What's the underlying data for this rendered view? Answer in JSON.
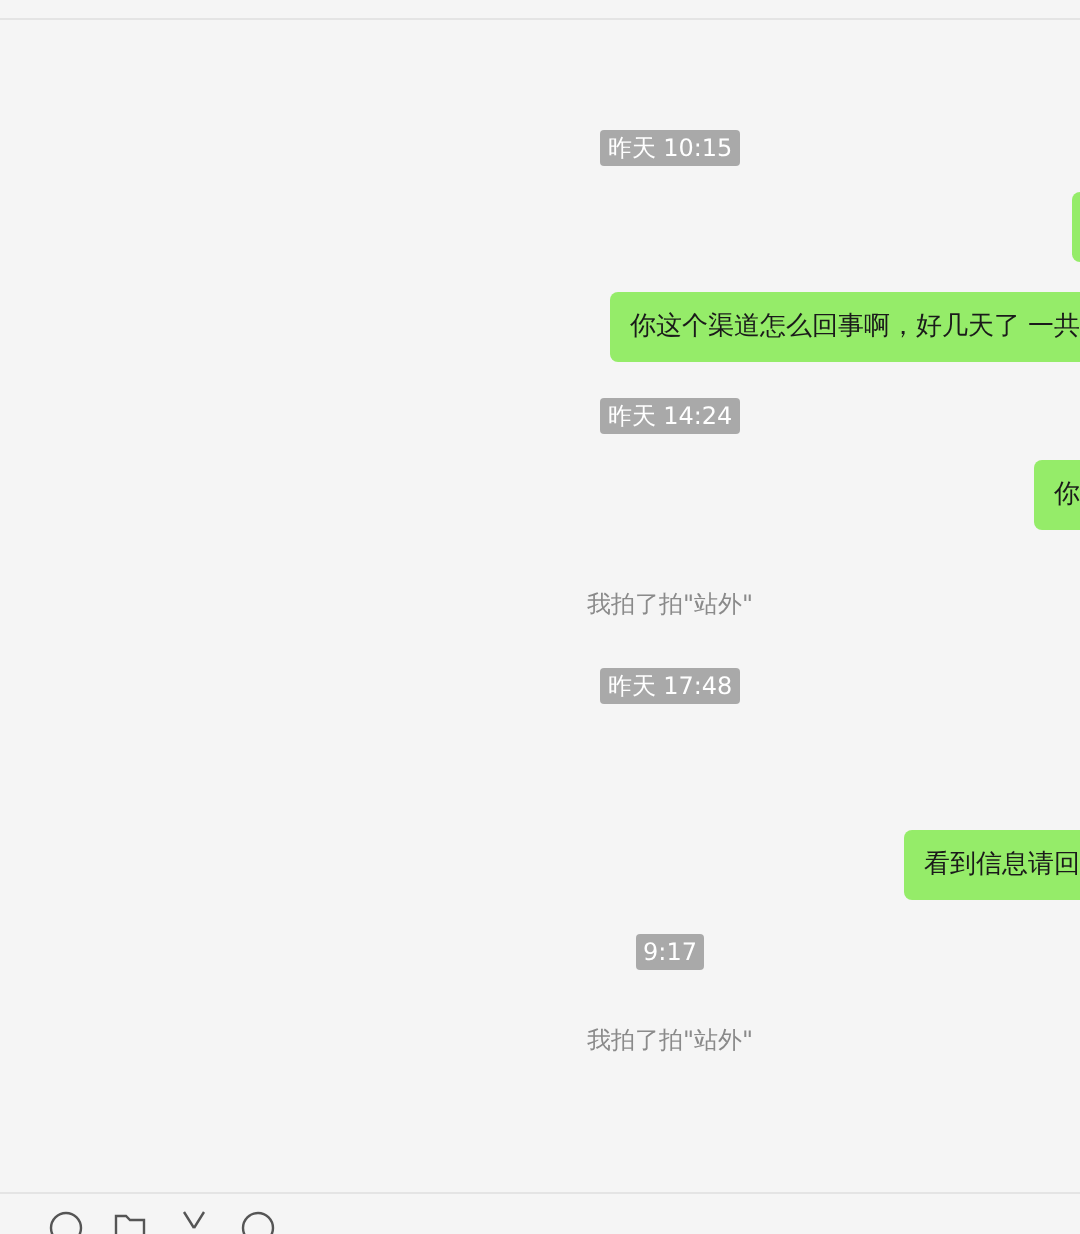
{
  "messages": [
    {
      "kind": "time",
      "text": "昨天 10:15"
    },
    {
      "kind": "message"
    },
    {
      "kind": "message",
      "text": "你这个渠道怎么回事啊，好几天了  一共"
    },
    {
      "kind": "time",
      "text": "昨天 14:24"
    },
    {
      "kind": "message",
      "text": "你"
    },
    {
      "kind": "notice",
      "text": "我拍了拍\"站外\""
    },
    {
      "kind": "time",
      "text": "昨天 17:48"
    },
    {
      "kind": "message",
      "text": "看到信息请回"
    },
    {
      "kind": "time",
      "text": "9:17"
    },
    {
      "kind": "notice",
      "text": "我拍了拍\"站外\""
    }
  ]
}
